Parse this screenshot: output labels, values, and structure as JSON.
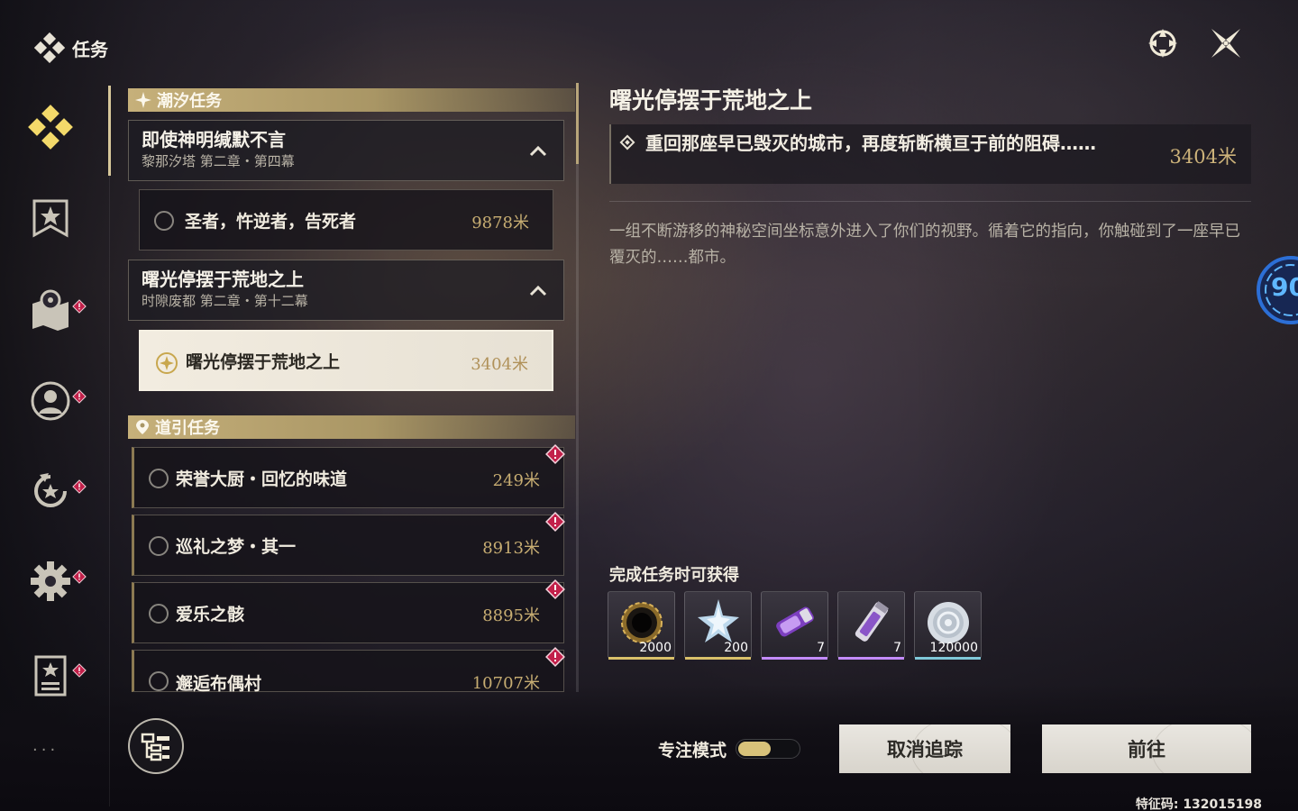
{
  "app": {
    "title": "任务"
  },
  "top_icons": [
    "target-crosshair-icon",
    "close-x-icon"
  ],
  "sidebar": {
    "items": [
      {
        "icon": "quest-diamond-icon",
        "active": true,
        "alert": false
      },
      {
        "icon": "bookmark-star-icon",
        "active": false,
        "alert": false
      },
      {
        "icon": "map-pin-icon",
        "active": false,
        "alert": true
      },
      {
        "icon": "character-profile-icon",
        "active": false,
        "alert": true
      },
      {
        "icon": "star-rewind-icon",
        "active": false,
        "alert": true
      },
      {
        "icon": "settings-gear-icon",
        "active": false,
        "alert": true
      },
      {
        "icon": "document-star-icon",
        "active": false,
        "alert": true
      }
    ],
    "more": "···"
  },
  "tide_section": {
    "title": "潮汐任务",
    "chapters": [
      {
        "title": "即使神明缄默不言",
        "subtitle": "黎那汐塔 第二章・第四幕",
        "quest": {
          "name": "圣者，忤逆者，告死者",
          "distance": "9878米",
          "selected": false
        }
      },
      {
        "title": "曙光停摆于荒地之上",
        "subtitle": "时隙废都 第二章・第十二幕",
        "quest": {
          "name": "曙光停摆于荒地之上",
          "distance": "3404米",
          "selected": true
        }
      }
    ]
  },
  "guide_section": {
    "title": "道引任务",
    "quests": [
      {
        "name": "荣誉大厨・回忆的味道",
        "distance": "249米"
      },
      {
        "name": "巡礼之梦・其一",
        "distance": "8913米"
      },
      {
        "name": "爱乐之骸",
        "distance": "8895米"
      },
      {
        "name": "邂逅布偶村",
        "distance": "10707米"
      }
    ]
  },
  "detail": {
    "title": "曙光停摆于荒地之上",
    "objective": "重回那座早已毁灭的城市，再度斩断横亘于前的阻碍……",
    "objective_distance": "3404米",
    "description": "一组不断游移的神秘空间坐标意外进入了你们的视野。循着它的指向，你触碰到了一座早已覆灭的……都市。"
  },
  "rewards": {
    "label": "完成任务时可获得",
    "items": [
      {
        "icon": "dark-ring-icon",
        "count": "2000",
        "rarity_color": "#d9c06a"
      },
      {
        "icon": "crystal-star-icon",
        "count": "200",
        "rarity_color": "#d9c06a"
      },
      {
        "icon": "purple-capsule-icon",
        "count": "7",
        "rarity_color": "#c38bff"
      },
      {
        "icon": "vial-icon",
        "count": "7",
        "rarity_color": "#c38bff"
      },
      {
        "icon": "silver-coin-icon",
        "count": "120000",
        "rarity_color": "#7fc8d8"
      }
    ]
  },
  "edge_widget": {
    "value": "90"
  },
  "footer": {
    "focus_mode_label": "专注模式",
    "cancel_label": "取消追踪",
    "go_label": "前往",
    "code": "特征码: 132015198"
  },
  "colors": {
    "accent_gold": "#c6b07a",
    "alert_red": "#c2204a",
    "edge_blue": "#5fb7ff"
  }
}
